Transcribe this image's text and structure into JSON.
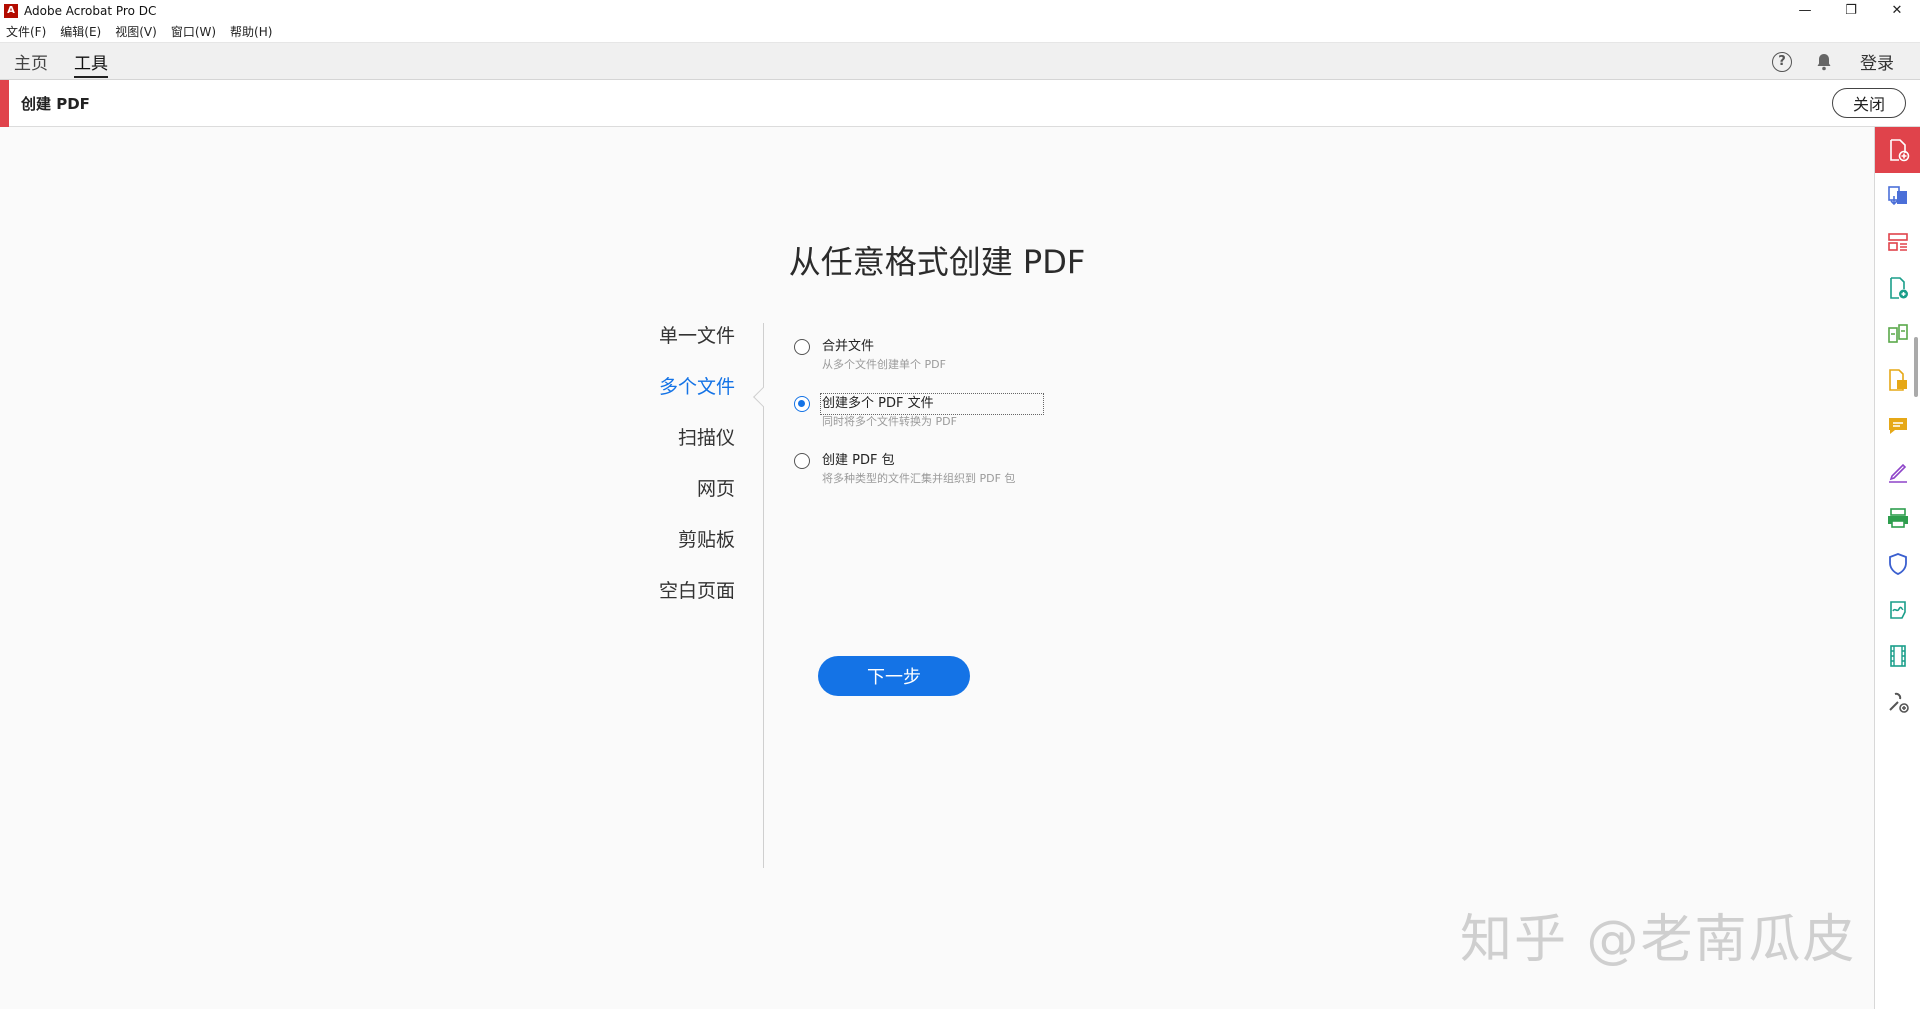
{
  "window": {
    "title": "Adobe Acrobat Pro DC",
    "controls": {
      "minimize": "—",
      "restore": "❐",
      "close": "✕"
    }
  },
  "menu": [
    "文件(F)",
    "编辑(E)",
    "视图(V)",
    "窗口(W)",
    "帮助(H)"
  ],
  "tabs": [
    {
      "label": "主页",
      "active": false
    },
    {
      "label": "工具",
      "active": true
    }
  ],
  "topbar": {
    "help": "?",
    "login": "登录"
  },
  "tool": {
    "title": "创建 PDF",
    "close_label": "关闭"
  },
  "main": {
    "heading": "从任意格式创建 PDF",
    "nav": [
      {
        "label": "单一文件",
        "active": false
      },
      {
        "label": "多个文件",
        "active": true
      },
      {
        "label": "扫描仪",
        "active": false
      },
      {
        "label": "网页",
        "active": false
      },
      {
        "label": "剪贴板",
        "active": false
      },
      {
        "label": "空白页面",
        "active": false
      }
    ],
    "options": [
      {
        "label": "合并文件",
        "desc": "从多个文件创建单个 PDF",
        "checked": false
      },
      {
        "label": "创建多个 PDF 文件",
        "desc": "同时将多个文件转换为 PDF",
        "checked": true
      },
      {
        "label": "创建 PDF 包",
        "desc": "将多种类型的文件汇集并组织到 PDF 包",
        "checked": false
      }
    ],
    "next_label": "下一步"
  },
  "watermark": "知乎 @老南瓜皮",
  "colors": {
    "accent_red": "#e0434b",
    "primary_blue": "#1473e6"
  },
  "right_rail": [
    {
      "name": "create-pdf-icon",
      "color": "#ffffff"
    },
    {
      "name": "export-pdf-icon",
      "color": "#4b6fd8"
    },
    {
      "name": "organize-pages-icon",
      "color": "#e0434b"
    },
    {
      "name": "edit-pdf-icon",
      "color": "#1a9e8a"
    },
    {
      "name": "compare-files-icon",
      "color": "#5aa84a"
    },
    {
      "name": "combine-files-icon",
      "color": "#e6a817"
    },
    {
      "name": "comment-icon",
      "color": "#e6a817"
    },
    {
      "name": "fill-sign-icon",
      "color": "#8e44c9"
    },
    {
      "name": "scan-ocr-icon",
      "color": "#2e9e4e"
    },
    {
      "name": "protect-icon",
      "color": "#3a5fcf"
    },
    {
      "name": "send-for-signature-icon",
      "color": "#1a9e8a"
    },
    {
      "name": "rich-media-icon",
      "color": "#1a9e8a"
    },
    {
      "name": "more-tools-icon",
      "color": "#555555"
    }
  ]
}
